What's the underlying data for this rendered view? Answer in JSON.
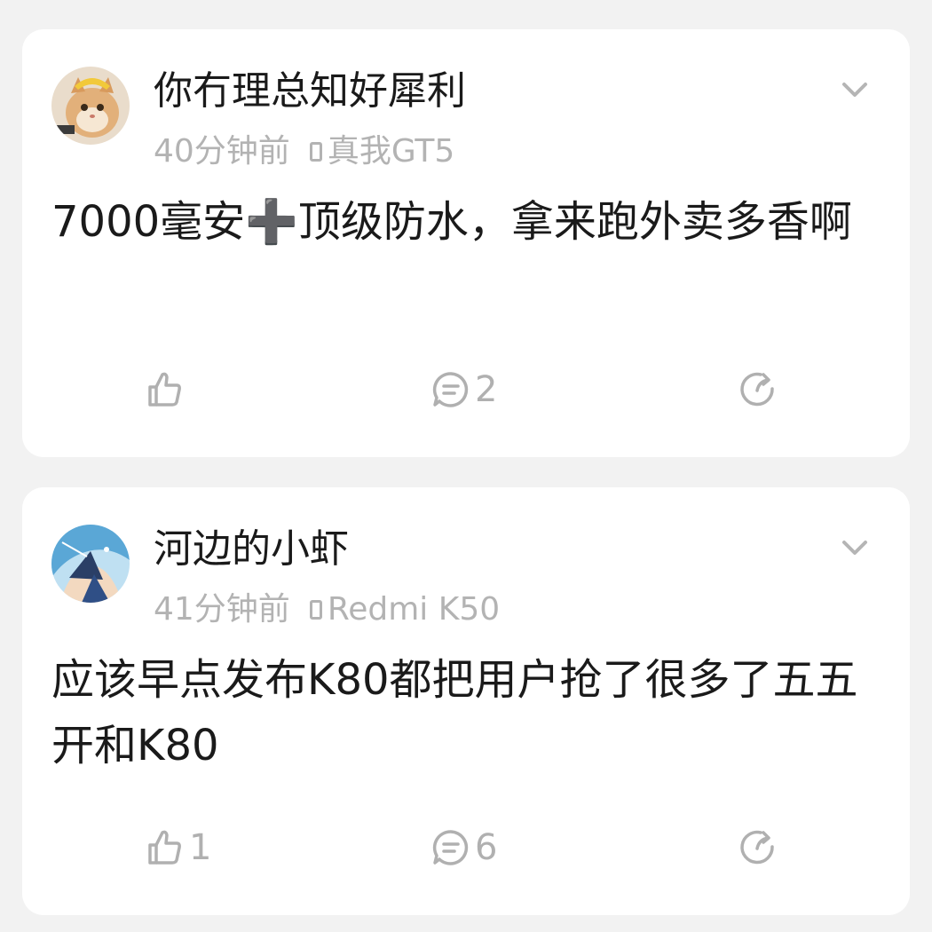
{
  "posts": [
    {
      "username": "你冇理总知好犀利",
      "time": "40分钟前",
      "device": "真我GT5",
      "content": "7000毫安➕顶级防水，拿来跑外卖多香啊",
      "likes": "",
      "comments": "2",
      "avatar_icon": "cat-avatar"
    },
    {
      "username": "河边的小虾",
      "time": "41分钟前",
      "device": "Redmi K50",
      "content": "应该早点发布K80都把用户抢了很多了五五开和K80",
      "likes": "1",
      "comments": "6",
      "avatar_icon": "anime-avatar"
    }
  ],
  "icons": {
    "like": "thumbs-up-icon",
    "comment": "comment-icon",
    "share": "share-icon",
    "more": "chevron-down-icon",
    "device": "phone-icon"
  },
  "colors": {
    "background": "#f2f2f2",
    "card": "#ffffff",
    "text": "#1a1a1a",
    "meta": "#b3b3b3",
    "icon": "#b0b0b0"
  }
}
